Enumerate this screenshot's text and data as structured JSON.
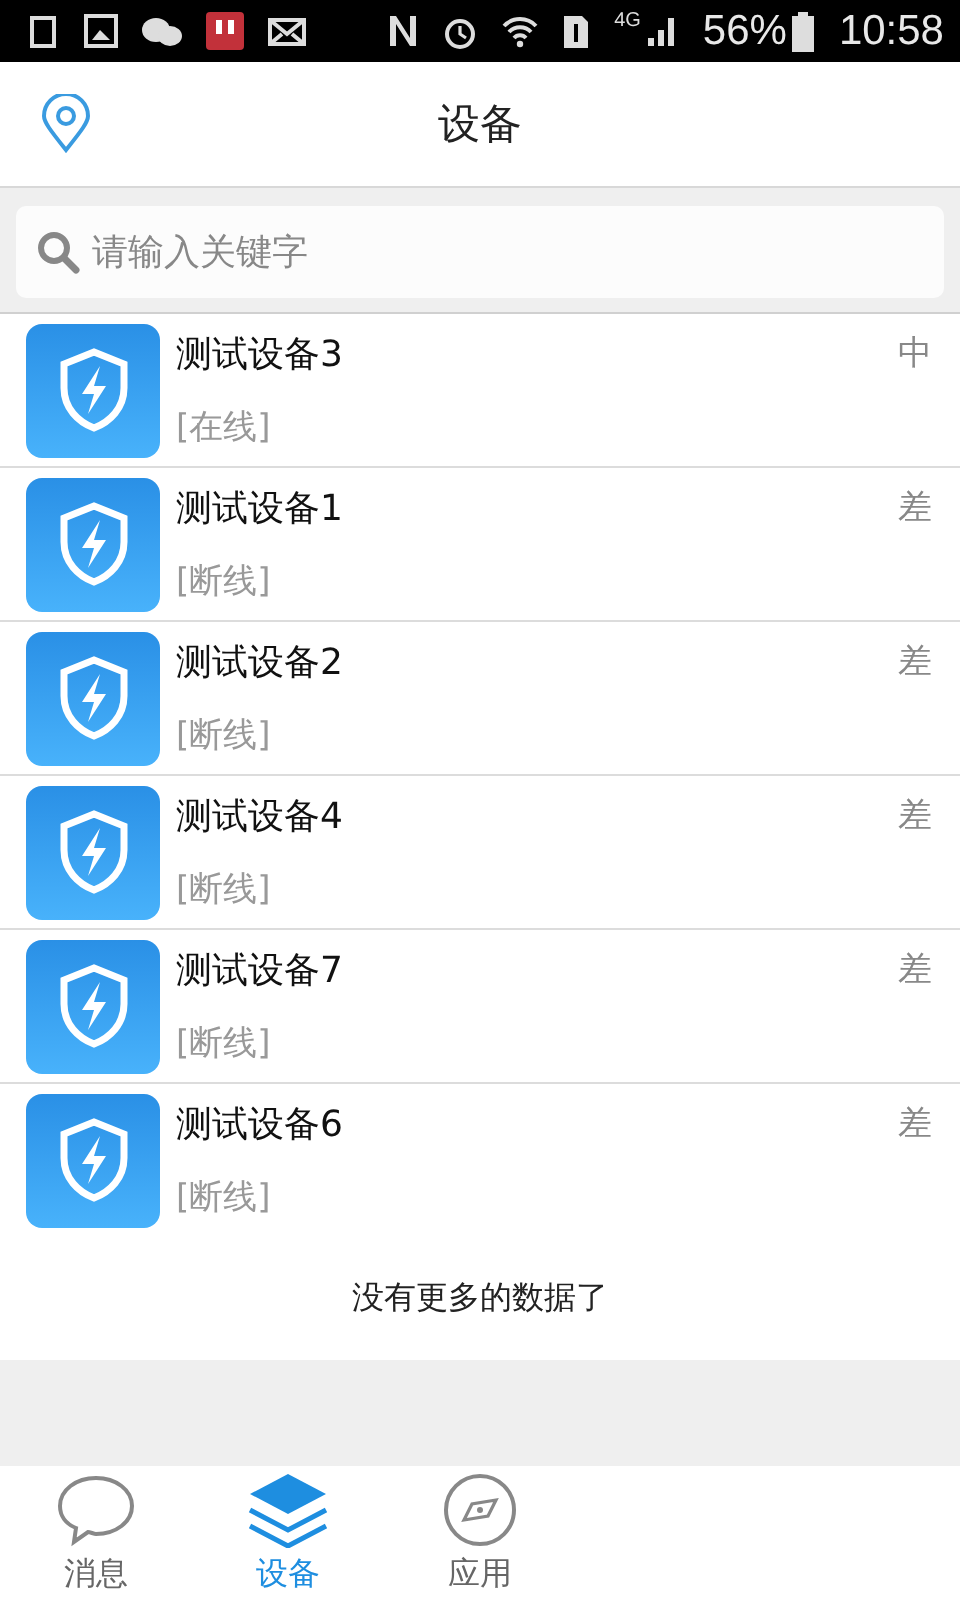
{
  "status_bar": {
    "network": "4G",
    "battery": "56%",
    "time": "10:58"
  },
  "header": {
    "title": "设备"
  },
  "search": {
    "placeholder": "请输入关键字"
  },
  "devices": [
    {
      "name": "测试设备3",
      "status": "[在线]",
      "signal": "中"
    },
    {
      "name": "测试设备1",
      "status": "[断线]",
      "signal": "差"
    },
    {
      "name": "测试设备2",
      "status": "[断线]",
      "signal": "差"
    },
    {
      "name": "测试设备4",
      "status": "[断线]",
      "signal": "差"
    },
    {
      "name": "测试设备7",
      "status": "[断线]",
      "signal": "差"
    },
    {
      "name": "测试设备6",
      "status": "[断线]",
      "signal": "差"
    }
  ],
  "list_footer": "没有更多的数据了",
  "tabs": [
    {
      "label": "消息",
      "kind": "chat",
      "selected": false
    },
    {
      "label": "设备",
      "kind": "layers",
      "selected": true
    },
    {
      "label": "应用",
      "kind": "compass",
      "selected": false
    }
  ]
}
